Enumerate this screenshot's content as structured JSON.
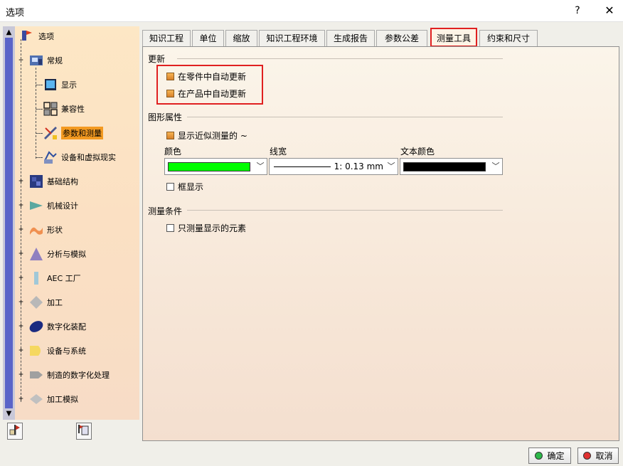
{
  "window": {
    "title": "选项",
    "help": "?",
    "close": "✕"
  },
  "tree": {
    "items": [
      {
        "label": "选项",
        "icon": "options-tree-root-icon"
      },
      {
        "label": "常规",
        "icon": "general-icon"
      },
      {
        "label": "显示",
        "icon": "display-icon"
      },
      {
        "label": "兼容性",
        "icon": "compatibility-icon"
      },
      {
        "label": "参数和测量",
        "icon": "parameters-measure-icon"
      },
      {
        "label": "设备和虚拟现实",
        "icon": "devices-vr-icon"
      },
      {
        "label": "基础结构",
        "icon": "infrastructure-icon"
      },
      {
        "label": "机械设计",
        "icon": "mechanical-design-icon"
      },
      {
        "label": "形状",
        "icon": "shape-icon"
      },
      {
        "label": "分析与模拟",
        "icon": "analysis-simulation-icon"
      },
      {
        "label": "AEC 工厂",
        "icon": "aec-plant-icon"
      },
      {
        "label": "加工",
        "icon": "machining-icon"
      },
      {
        "label": "数字化装配",
        "icon": "digital-mockup-icon"
      },
      {
        "label": "设备与系统",
        "icon": "equipment-systems-icon"
      },
      {
        "label": "制造的数字化处理",
        "icon": "digital-manufacturing-icon"
      },
      {
        "label": "加工模拟",
        "icon": "machining-simulation-icon"
      }
    ]
  },
  "tabs": [
    {
      "label": "知识工程"
    },
    {
      "label": "单位"
    },
    {
      "label": "缩放"
    },
    {
      "label": "知识工程环境"
    },
    {
      "label": "生成报告"
    },
    {
      "label": "参数公差"
    },
    {
      "label": "测量工具"
    },
    {
      "label": "约束和尺寸"
    }
  ],
  "sections": {
    "update": {
      "title": "更新",
      "auto_update_part": "在零件中自动更新",
      "auto_update_product": "在产品中自动更新"
    },
    "graphics": {
      "title": "图形属性",
      "show_near_measure": "显示近似测量的 ~",
      "color_label": "颜色",
      "linewidth_label": "线宽",
      "text_color_label": "文本颜色",
      "linewidth_value": "1: 0.13 mm",
      "frame_display": "框显示",
      "color_value": "#00ff00",
      "text_color_value": "#000000"
    },
    "measure_condition": {
      "title": "测量条件",
      "only_displayed": "只测量显示的元素"
    }
  },
  "buttons": {
    "ok": "确定",
    "cancel": "取消"
  }
}
